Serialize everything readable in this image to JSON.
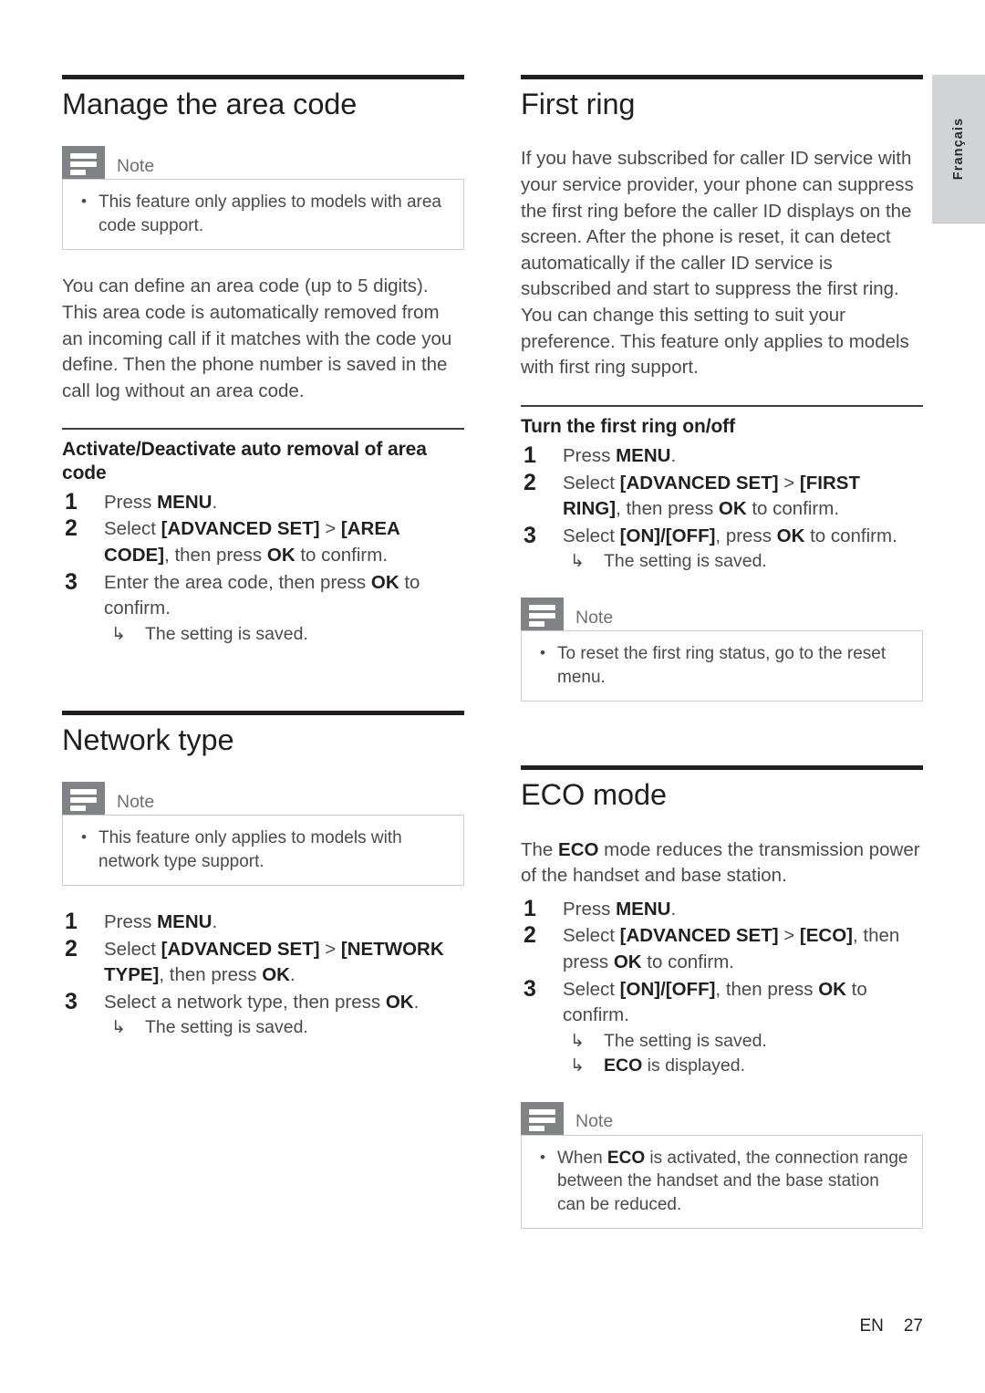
{
  "page": {
    "language_tab": "Français",
    "footer_language": "EN",
    "footer_page_number": "27"
  },
  "note_label": "Note",
  "left_column": {
    "section_1": {
      "title": "Manage the area code",
      "note": {
        "label": "Note",
        "items": [
          "This feature only applies to models with area code support."
        ]
      },
      "paragraph": "You can define an area code (up to 5 digits). This area code is automatically removed from an incoming call if it matches with the code you define. Then the phone number is saved in the call log without an area code.",
      "subsection": {
        "title": "Activate/Deactivate auto removal of area code",
        "steps": [
          {
            "num": "1",
            "text": "Press MENU."
          },
          {
            "num": "2",
            "text": "Select [ADVANCED SET] > [AREA CODE], then press OK to confirm."
          },
          {
            "num": "3",
            "text": "Enter the area code, then press OK to confirm.",
            "result": "The setting is saved."
          }
        ]
      }
    },
    "section_2": {
      "title": "Network type",
      "note": {
        "label": "Note",
        "items": [
          "This feature only applies to models with network type support."
        ]
      },
      "steps": [
        {
          "num": "1",
          "text": "Press MENU."
        },
        {
          "num": "2",
          "text": "Select [ADVANCED SET] > [NETWORK TYPE], then press OK."
        },
        {
          "num": "3",
          "text": "Select a network type, then press OK.",
          "result": "The setting is saved."
        }
      ]
    }
  },
  "right_column": {
    "section_1": {
      "title": "First ring",
      "paragraph": "If you have subscribed for caller ID service with your service provider, your phone can suppress the first ring before the caller ID displays on the screen. After the phone is reset, it can detect automatically if the caller ID service is subscribed and start to suppress the first ring. You can change this setting to suit your preference. This feature only applies to models with first ring support.",
      "subsection": {
        "title": "Turn the first ring on/off",
        "steps": [
          {
            "num": "1",
            "text": "Press MENU."
          },
          {
            "num": "2",
            "text": "Select [ADVANCED SET] > [FIRST RING], then press OK to confirm."
          },
          {
            "num": "3",
            "text": "Select [ON]/[OFF], press OK to confirm.",
            "result": "The setting is saved."
          }
        ]
      },
      "note": {
        "label": "Note",
        "items": [
          "To reset the first ring status, go to the reset menu."
        ]
      }
    },
    "section_2": {
      "title": "ECO mode",
      "paragraph": "The ECO mode reduces the transmission power of the handset and base station.",
      "steps": [
        {
          "num": "1",
          "text": "Press MENU."
        },
        {
          "num": "2",
          "text": "Select [ADVANCED SET] > [ECO], then press OK to confirm."
        },
        {
          "num": "3",
          "text": "Select [ON]/[OFF], then press OK to confirm.",
          "result": "The setting is saved.",
          "result2": "ECO is displayed."
        }
      ],
      "note": {
        "label": "Note",
        "items": [
          "When ECO is activated, the connection range between the handset and the base station can be reduced."
        ]
      }
    }
  }
}
